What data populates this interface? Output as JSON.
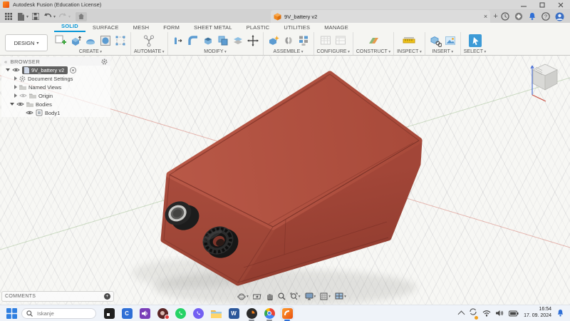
{
  "app": {
    "title": "Autodesk Fusion (Education License)"
  },
  "document_tab": {
    "label": "9V_battery v2"
  },
  "ribbon": {
    "context": "DESIGN",
    "tabs": [
      {
        "label": "SOLID",
        "active": true
      },
      {
        "label": "SURFACE"
      },
      {
        "label": "MESH"
      },
      {
        "label": "FORM"
      },
      {
        "label": "SHEET METAL"
      },
      {
        "label": "PLASTIC"
      },
      {
        "label": "UTILITIES"
      },
      {
        "label": "MANAGE"
      }
    ],
    "groups": [
      {
        "label": "CREATE"
      },
      {
        "label": "AUTOMATE"
      },
      {
        "label": "MODIFY"
      },
      {
        "label": "ASSEMBLE"
      },
      {
        "label": "CONFIGURE"
      },
      {
        "label": "CONSTRUCT"
      },
      {
        "label": "INSPECT"
      },
      {
        "label": "INSERT"
      },
      {
        "label": "SELECT"
      }
    ]
  },
  "browser": {
    "title": "BROWSER",
    "root_label": "9V_battery v2",
    "items": [
      {
        "label": "Document Settings"
      },
      {
        "label": "Named Views"
      },
      {
        "label": "Origin"
      },
      {
        "label": "Bodies"
      },
      {
        "label": "Body1"
      }
    ]
  },
  "comments": {
    "label": "COMMENTS"
  },
  "canvas": {
    "model": "9V battery case body",
    "body_color": "#a84a3c",
    "grid": "on"
  },
  "icons": {
    "collapse": "«"
  },
  "taskbar": {
    "search_placeholder": "Iskanje",
    "clock": {
      "time": "16:54",
      "date": "17. 09. 2024"
    }
  }
}
